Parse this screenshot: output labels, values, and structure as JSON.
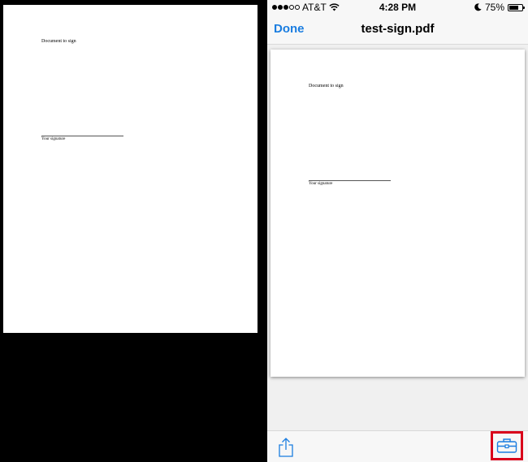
{
  "document": {
    "title_text": "Document to sign",
    "signature_label": "Your signature"
  },
  "statusbar": {
    "carrier": "AT&T",
    "time": "4:28 PM",
    "battery_percent": "75%",
    "battery_level": 0.75,
    "signal_bars_filled": 3,
    "signal_bars_total": 5
  },
  "navbar": {
    "done_label": "Done",
    "title": "test-sign.pdf"
  },
  "toolbar": {
    "share_icon": "share-icon",
    "tools_icon": "toolbox-icon",
    "highlight_color": "#d9001b"
  },
  "colors": {
    "accent": "#1a7de0"
  }
}
